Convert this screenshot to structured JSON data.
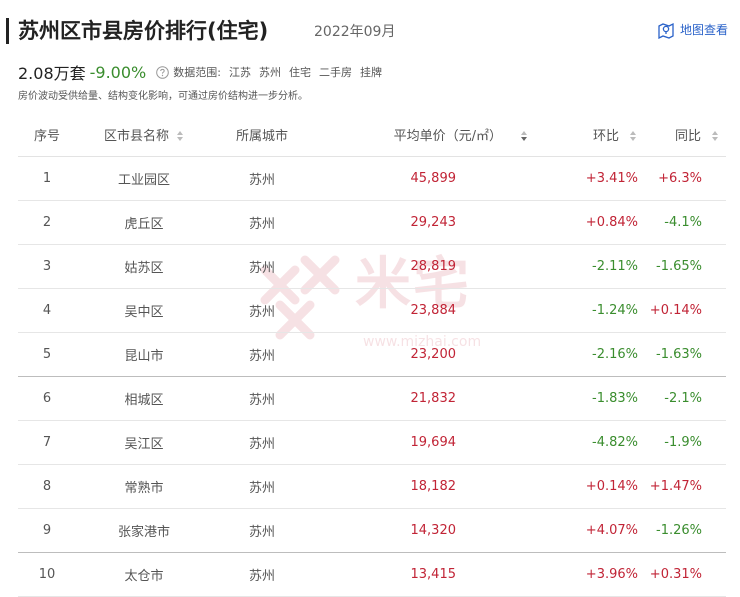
{
  "header": {
    "title": "苏州区市县房价排行(住宅)",
    "period": "2022年09月",
    "map_link_label": "地图查看"
  },
  "summary": {
    "avg_price": "2.08万套",
    "change": "-9.00%",
    "scope_label": "数据范围:",
    "scope_tags": [
      "江苏",
      "苏州",
      "住宅",
      "二手房",
      "挂牌"
    ],
    "note": "房价波动受供给量、结构变化影响，可通过房价结构进一步分析。"
  },
  "table": {
    "columns": [
      "序号",
      "区市县名称",
      "所属城市",
      "平均单价（元/㎡）",
      "环比",
      "同比"
    ],
    "rows": [
      {
        "idx": "1",
        "name": "工业园区",
        "city": "苏州",
        "price": "45,899",
        "mom": "+3.41%",
        "yoy": "+6.3%"
      },
      {
        "idx": "2",
        "name": "虎丘区",
        "city": "苏州",
        "price": "29,243",
        "mom": "+0.84%",
        "yoy": "-4.1%"
      },
      {
        "idx": "3",
        "name": "姑苏区",
        "city": "苏州",
        "price": "28,819",
        "mom": "-2.11%",
        "yoy": "-1.65%"
      },
      {
        "idx": "4",
        "name": "吴中区",
        "city": "苏州",
        "price": "23,884",
        "mom": "-1.24%",
        "yoy": "+0.14%"
      },
      {
        "idx": "5",
        "name": "昆山市",
        "city": "苏州",
        "price": "23,200",
        "mom": "-2.16%",
        "yoy": "-1.63%"
      },
      {
        "idx": "6",
        "name": "相城区",
        "city": "苏州",
        "price": "21,832",
        "mom": "-1.83%",
        "yoy": "-2.1%"
      },
      {
        "idx": "7",
        "name": "吴江区",
        "city": "苏州",
        "price": "19,694",
        "mom": "-4.82%",
        "yoy": "-1.9%"
      },
      {
        "idx": "8",
        "name": "常熟市",
        "city": "苏州",
        "price": "18,182",
        "mom": "+0.14%",
        "yoy": "+1.47%"
      },
      {
        "idx": "9",
        "name": "张家港市",
        "city": "苏州",
        "price": "14,320",
        "mom": "+4.07%",
        "yoy": "-1.26%"
      },
      {
        "idx": "10",
        "name": "太仓市",
        "city": "苏州",
        "price": "13,415",
        "mom": "+3.96%",
        "yoy": "+0.31%"
      }
    ]
  },
  "watermark": {
    "text": "米宅",
    "url": "www.mizhai.com"
  },
  "colors": {
    "up": "#c12436",
    "down": "#3a8d2e",
    "link": "#2a62c9"
  },
  "icons": {
    "map": "map-marker-icon",
    "help": "question-circle-icon",
    "sort": "sort-arrows-icon"
  }
}
